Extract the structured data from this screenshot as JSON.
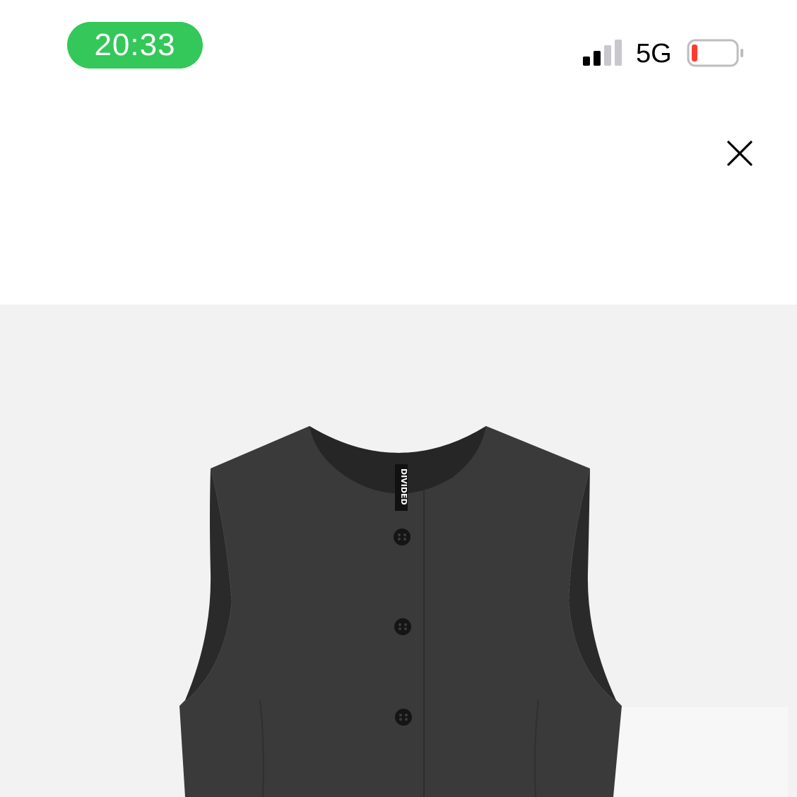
{
  "status_bar": {
    "time": "20:33",
    "network": "5G",
    "time_pill_color": "#34c759",
    "battery_level_fraction": 0.12,
    "battery_fill_color": "#ff3b30",
    "signal_bars_active": 2,
    "signal_bars_total": 4
  },
  "toolbar": {
    "close_icon": "close-icon"
  },
  "product": {
    "image_icon": "vest-image",
    "brand_tag": "DIVIDED",
    "background_color": "#f2f2f2",
    "garment_color": "#3a3a3a"
  }
}
